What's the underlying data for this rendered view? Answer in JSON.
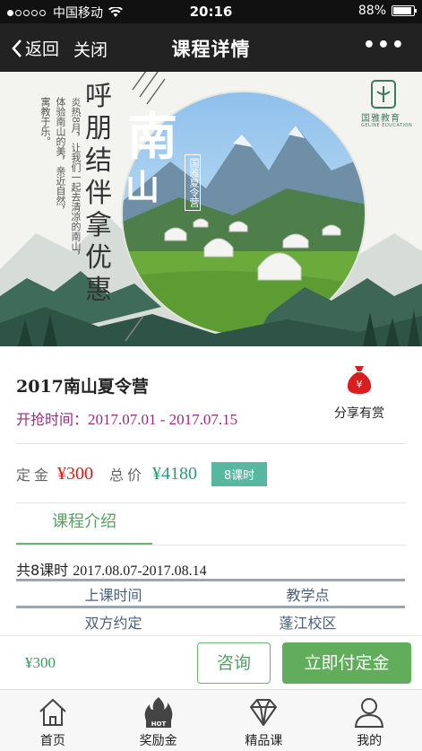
{
  "status_bar": {
    "carrier": "中国移动",
    "time": "20:16",
    "battery": "88%"
  },
  "nav": {
    "back_label": "返回",
    "close_label": "关闭",
    "title": "课程详情",
    "more_label": "•••"
  },
  "banner": {
    "logo_text": "国雅教育",
    "logo_sub": "GELINE EDUCATION",
    "title_chars": [
      "南",
      "山"
    ],
    "slogan_chars": [
      "呼",
      "朋",
      "结",
      "伴",
      "拿",
      "优",
      "惠"
    ],
    "poem_lines": [
      "炎热8月，让我们一起去清凉的南山，",
      "体验南山的美，亲近自然，",
      "寓教于乐。"
    ],
    "stamp_text": "国雅夏令营"
  },
  "course": {
    "title": "2017南山夏令营",
    "rush_label": "开抢时间：",
    "rush_value": "2017.07.01 - 2017.07.15",
    "share_label": "分享有赏",
    "bag_symbol": "¥"
  },
  "price": {
    "deposit_label": "定金",
    "deposit_value": "¥300",
    "total_label": "总价",
    "total_value": "¥4180",
    "lessons_tag": "8课时"
  },
  "tabs": {
    "intro": "课程介绍"
  },
  "schedule": {
    "summary_prefix": "共8课时",
    "summary_dates": "2017.08.07-2017.08.14",
    "headers": [
      "上课时间",
      "教学点"
    ],
    "rows": [
      [
        "双方约定",
        "蓬江校区"
      ]
    ]
  },
  "action_bar": {
    "amount": "¥300",
    "consult_label": "咨询",
    "pay_label": "立即付定金"
  },
  "bottom_nav": [
    {
      "label": "首页",
      "icon": "home-icon"
    },
    {
      "label": "奖励金",
      "icon": "hot-flame-icon",
      "badge": "HOT"
    },
    {
      "label": "精品课",
      "icon": "diamond-icon"
    },
    {
      "label": "我的",
      "icon": "user-icon"
    }
  ],
  "colors": {
    "accent_green": "#62ad5b",
    "price_red": "#e01c1c",
    "purple": "#9b2a86",
    "teal_tag": "#56b8a0"
  }
}
